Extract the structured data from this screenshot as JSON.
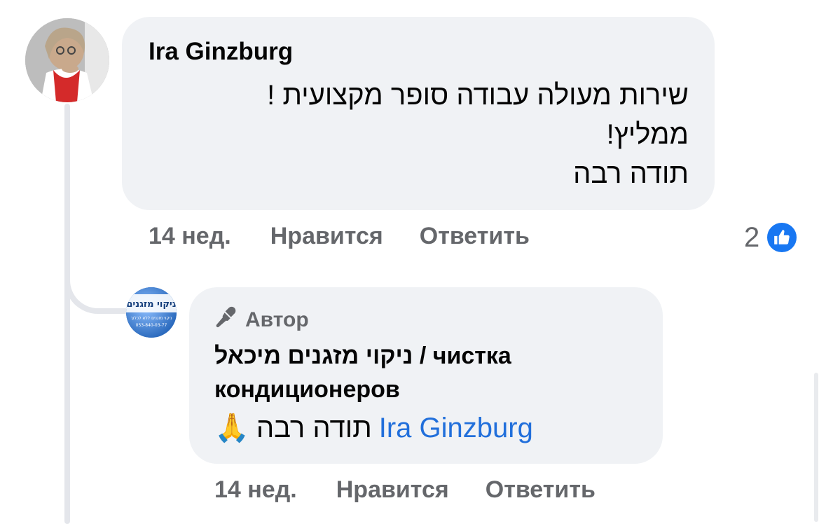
{
  "comment": {
    "author": "Ira Ginzburg",
    "lines": [
      "שירות מעולה עבודה סופר מקצועית !",
      "ממליץ!",
      "תודה רבה"
    ],
    "time": "14 нед.",
    "like_label": "Нравится",
    "reply_label": "Ответить",
    "reaction_count": "2",
    "reaction_icon": "thumbs-up-icon"
  },
  "reply": {
    "badge": "Автор",
    "badge_icon": "microphone-icon",
    "author": "ניקוי מזגנים מיכאל / чистка кондиционеров",
    "mention": "Ira Ginzburg",
    "text": "תודה רבה",
    "emoji": "🙏",
    "time": "14 нед.",
    "like_label": "Нравится",
    "reply_label": "Ответить"
  },
  "reply_avatar": {
    "title": "ניקוי מזגנים",
    "subtitle": "ניקוי מזגנים ללא לכלוך",
    "phone": "053-840-03-77"
  },
  "colors": {
    "bubble": "#f0f2f5",
    "meta_text": "#65676b",
    "mention": "#216fdb",
    "like": "#1877f2",
    "thread_line": "#e4e6eb"
  }
}
